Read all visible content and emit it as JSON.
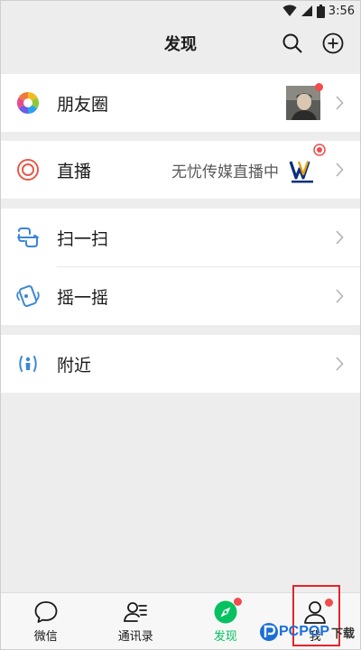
{
  "status": {
    "time": "3:56"
  },
  "header": {
    "title": "发现",
    "search_icon": "search-icon",
    "add_icon": "plus-circle-icon"
  },
  "list": {
    "moments": {
      "label": "朋友圈",
      "icon": "moments-aperture-icon",
      "has_dot": true
    },
    "live": {
      "label": "直播",
      "right_text": "无忧传媒直播中",
      "icon": "live-icon",
      "has_dot": true
    },
    "scan": {
      "label": "扫一扫",
      "icon": "scan-icon"
    },
    "shake": {
      "label": "摇一摇",
      "icon": "shake-icon"
    },
    "nearby": {
      "label": "附近",
      "icon": "nearby-icon"
    }
  },
  "tabs": [
    {
      "label": "微信",
      "icon": "chat-bubble-icon",
      "active": false
    },
    {
      "label": "通讯录",
      "icon": "contacts-icon",
      "active": false
    },
    {
      "label": "发现",
      "icon": "compass-icon",
      "active": true
    },
    {
      "label": "我",
      "icon": "person-icon",
      "active": false
    }
  ],
  "watermark": {
    "brand": "PCPOP",
    "suffix": "下载"
  },
  "colors": {
    "accent": "#07c160",
    "badge": "#f24c4c",
    "background": "#ededed",
    "highlight": "#e5242a"
  }
}
